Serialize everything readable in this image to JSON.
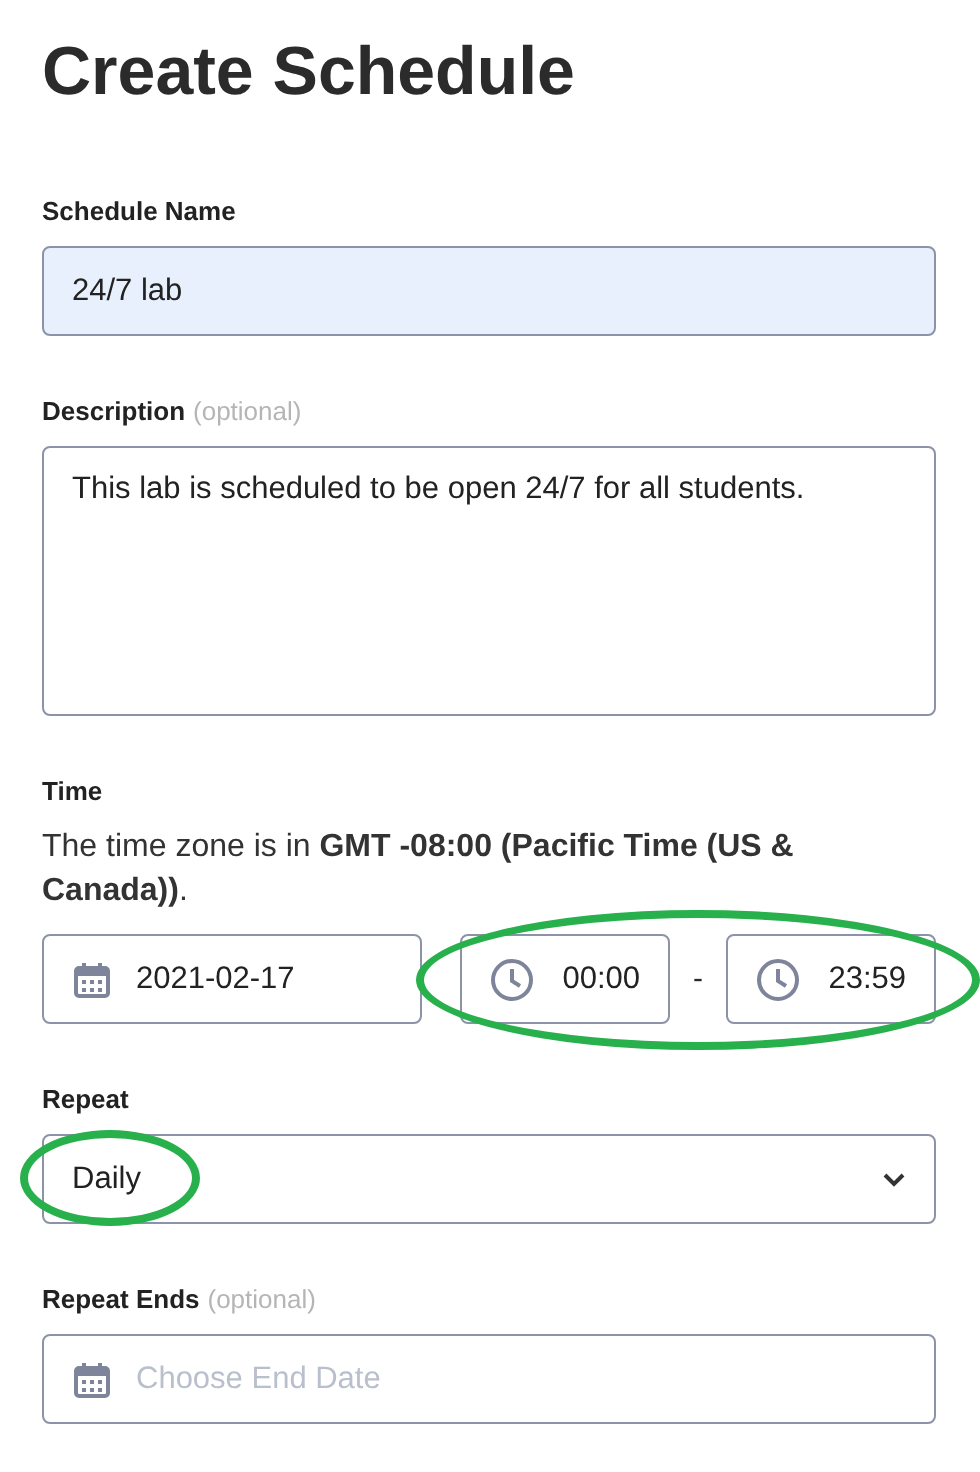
{
  "title": "Create Schedule",
  "schedule_name": {
    "label": "Schedule Name",
    "value": "24/7 lab",
    "autofilled": true
  },
  "description": {
    "label": "Description",
    "optional": "(optional)",
    "value": "This lab is scheduled to be open 24/7 for all students."
  },
  "time": {
    "label": "Time",
    "timezone_note": "The time zone is in **GMT -08:00 (Pacific Time (US & Canada))**.",
    "date": "2021-02-17",
    "start": "00:00",
    "separator": "-",
    "end": "23:59",
    "circled": true
  },
  "repeat": {
    "label": "Repeat",
    "value": "Daily",
    "circled": true
  },
  "repeat_ends": {
    "label": "Repeat Ends",
    "optional": "(optional)",
    "placeholder": "Choose End Date"
  }
}
